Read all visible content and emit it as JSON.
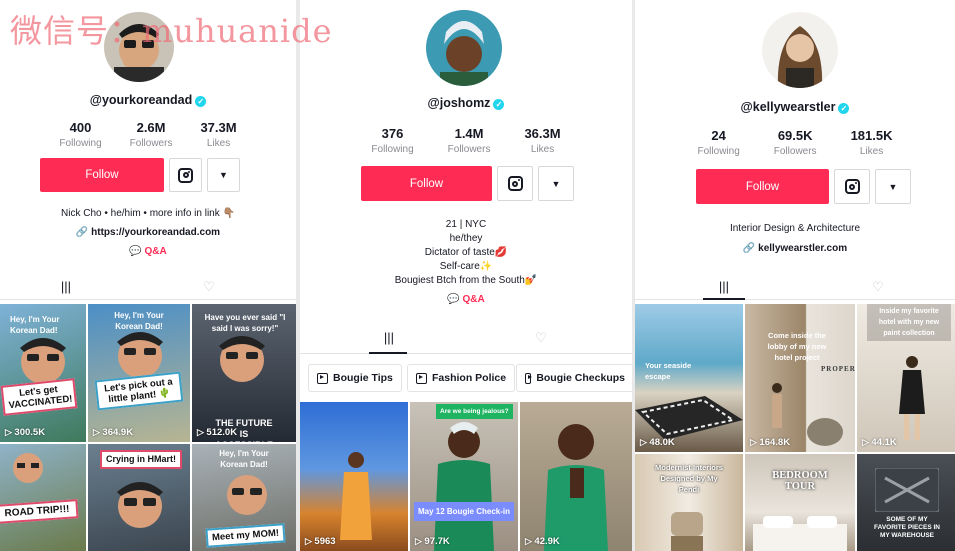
{
  "watermark": "微信号：muhuanide",
  "profiles": [
    {
      "handle": "@yourkoreandad",
      "stats": [
        {
          "value": "400",
          "label": "Following"
        },
        {
          "value": "2.6M",
          "label": "Followers"
        },
        {
          "value": "37.3M",
          "label": "Likes"
        }
      ],
      "follow_label": "Follow",
      "bio": "Nick Cho • he/him • more info in link 👇🏽",
      "link": "https://yourkoreandad.com",
      "qa_label": "Q&A",
      "videos": [
        {
          "caption": "Let's get VACCINATED!",
          "overlay": "Hey, I'm Your Korean Dad!",
          "views": "300.5K"
        },
        {
          "caption": "Let's pick out a little plant! 🌵",
          "overlay": "Hey, I'm Your Korean Dad!",
          "views": "364.9K"
        },
        {
          "caption": "THE FUTURE IS ACCESSIBLE",
          "overlay": "Have you ever said \"I said I was sorry!\"",
          "views": "512.0K"
        },
        {
          "caption": "ROAD TRIP!!!",
          "overlay": "",
          "views": ""
        },
        {
          "caption": "Crying in HMart!",
          "overlay": "",
          "views": ""
        },
        {
          "caption": "Meet my MOM!",
          "overlay": "Hey, I'm Your Korean Dad!",
          "views": ""
        }
      ]
    },
    {
      "handle": "@joshomz",
      "stats": [
        {
          "value": "376",
          "label": "Following"
        },
        {
          "value": "1.4M",
          "label": "Followers"
        },
        {
          "value": "36.3M",
          "label": "Likes"
        }
      ],
      "follow_label": "Follow",
      "bio_lines": [
        "21 | NYC",
        "he/they",
        "Dictator of taste💋",
        "Self-care✨",
        "Bougiest Btch from the South💅"
      ],
      "qa_label": "Q&A",
      "playlists": [
        "Bougie Tips",
        "Fashion Police",
        "Bougie Checkups"
      ],
      "videos": [
        {
          "caption": "",
          "views": "5963"
        },
        {
          "caption": "May 12 Bougie Check-in",
          "overlay": "Are we being jealous?",
          "views": "97.7K"
        },
        {
          "caption": "",
          "views": "42.9K"
        }
      ]
    },
    {
      "handle": "@kellywearstler",
      "stats": [
        {
          "value": "24",
          "label": "Following"
        },
        {
          "value": "69.5K",
          "label": "Followers"
        },
        {
          "value": "181.5K",
          "label": "Likes"
        }
      ],
      "follow_label": "Follow",
      "bio": "Interior Design & Architecture",
      "link": "kellywearstler.com",
      "videos": [
        {
          "caption": "",
          "overlay": "Your seaside escape",
          "views": "48.0K"
        },
        {
          "caption": "PROPER",
          "overlay": "Come inside the lobby of my new hotel project",
          "views": "164.8K"
        },
        {
          "caption": "",
          "overlay": "Inside my favorite hotel with my new paint collection",
          "views": "44.1K"
        },
        {
          "caption": "",
          "overlay": "Modernist Interiors Designed by My Pendi",
          "views": ""
        },
        {
          "caption": "BEDROOM TOUR",
          "overlay": "",
          "views": ""
        },
        {
          "caption": "SOME OF MY FAVORITE PIECES IN MY WAREHOUSE",
          "overlay": "",
          "views": ""
        }
      ]
    }
  ],
  "tab_icons": [
    "grid-icon",
    "liked-heart-icon"
  ],
  "colors": {
    "follow": "#fe2c55",
    "verified": "#20d5ec",
    "muted": "#8a8b91"
  }
}
